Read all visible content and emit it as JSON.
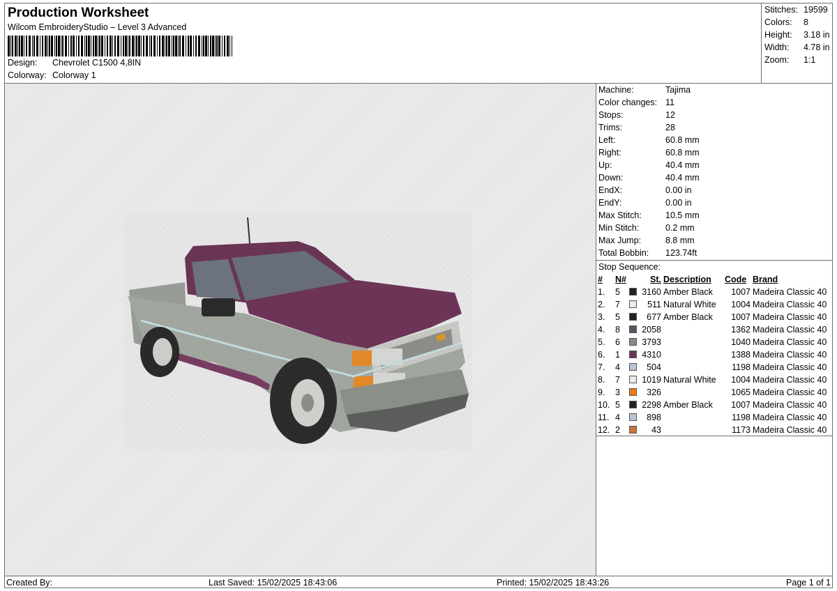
{
  "header": {
    "title": "Production Worksheet",
    "subtitle": "Wilcom EmbroideryStudio – Level 3 Advanced",
    "design_label": "Design:",
    "design_value": "Chevrolet C1500 4,8IN",
    "colorway_label": "Colorway:",
    "colorway_value": "Colorway 1"
  },
  "stats": [
    {
      "label": "Stitches:",
      "value": "19599"
    },
    {
      "label": "Colors:",
      "value": "8"
    },
    {
      "label": "Height:",
      "value": "3.18 in"
    },
    {
      "label": "Width:",
      "value": "4.78 in"
    },
    {
      "label": "Zoom:",
      "value": "1:1"
    }
  ],
  "machine": [
    {
      "label": "Machine:",
      "value": "Tajima"
    },
    {
      "label": "Color changes:",
      "value": "11"
    },
    {
      "label": "Stops:",
      "value": "12"
    },
    {
      "label": "Trims:",
      "value": "28"
    },
    {
      "label": "Left:",
      "value": "60.8 mm"
    },
    {
      "label": "Right:",
      "value": "60.8 mm"
    },
    {
      "label": "Up:",
      "value": "40.4 mm"
    },
    {
      "label": "Down:",
      "value": "40.4 mm"
    },
    {
      "label": "EndX:",
      "value": "0.00 in"
    },
    {
      "label": "EndY:",
      "value": "0.00 in"
    },
    {
      "label": "Max Stitch:",
      "value": "10.5 mm"
    },
    {
      "label": "Min Stitch:",
      "value": "0.2 mm"
    },
    {
      "label": "Max Jump:",
      "value": "8.8 mm"
    },
    {
      "label": "Total Bobbin:",
      "value": "123.74ft"
    }
  ],
  "stop_sequence": {
    "title": "Stop Sequence:",
    "headers": [
      "#",
      "N#",
      "St.",
      "Description",
      "Code",
      "Brand"
    ],
    "rows": [
      {
        "num": "1.",
        "n": "5",
        "color": "#222222",
        "st": "3160",
        "desc": "Amber Black",
        "code": "1007",
        "brand": "Madeira Classic 40"
      },
      {
        "num": "2.",
        "n": "7",
        "color": "#ebebeb",
        "st": "511",
        "desc": "Natural White",
        "code": "1004",
        "brand": "Madeira Classic 40"
      },
      {
        "num": "3.",
        "n": "5",
        "color": "#222222",
        "st": "677",
        "desc": "Amber Black",
        "code": "1007",
        "brand": "Madeira Classic 40"
      },
      {
        "num": "4.",
        "n": "8",
        "color": "#565665",
        "st": "2058",
        "desc": "",
        "code": "1362",
        "brand": "Madeira Classic 40"
      },
      {
        "num": "5.",
        "n": "6",
        "color": "#8a8a8a",
        "st": "3793",
        "desc": "",
        "code": "1040",
        "brand": "Madeira Classic 40"
      },
      {
        "num": "6.",
        "n": "1",
        "color": "#6b3556",
        "st": "4310",
        "desc": "",
        "code": "1388",
        "brand": "Madeira Classic 40"
      },
      {
        "num": "7.",
        "n": "4",
        "color": "#b8c4d4",
        "st": "504",
        "desc": "",
        "code": "1198",
        "brand": "Madeira Classic 40"
      },
      {
        "num": "8.",
        "n": "7",
        "color": "#ebebeb",
        "st": "1019",
        "desc": "Natural White",
        "code": "1004",
        "brand": "Madeira Classic 40"
      },
      {
        "num": "9.",
        "n": "3",
        "color": "#f07a1a",
        "st": "326",
        "desc": "",
        "code": "1065",
        "brand": "Madeira Classic 40"
      },
      {
        "num": "10.",
        "n": "5",
        "color": "#222222",
        "st": "2298",
        "desc": "Amber Black",
        "code": "1007",
        "brand": "Madeira Classic 40"
      },
      {
        "num": "11.",
        "n": "4",
        "color": "#b8c4d4",
        "st": "898",
        "desc": "",
        "code": "1198",
        "brand": "Madeira Classic 40"
      },
      {
        "num": "12.",
        "n": "2",
        "color": "#c8743a",
        "st": "43",
        "desc": "",
        "code": "1173",
        "brand": "Madeira Classic 40"
      }
    ]
  },
  "footer": {
    "created_by": "Created By:",
    "last_saved": "Last Saved: 15/02/2025 18:43:06",
    "printed": "Printed: 15/02/2025 18:43:26",
    "page": "Page 1 of 1"
  },
  "icons": {
    "design_preview": "pickup-truck-embroidery"
  }
}
